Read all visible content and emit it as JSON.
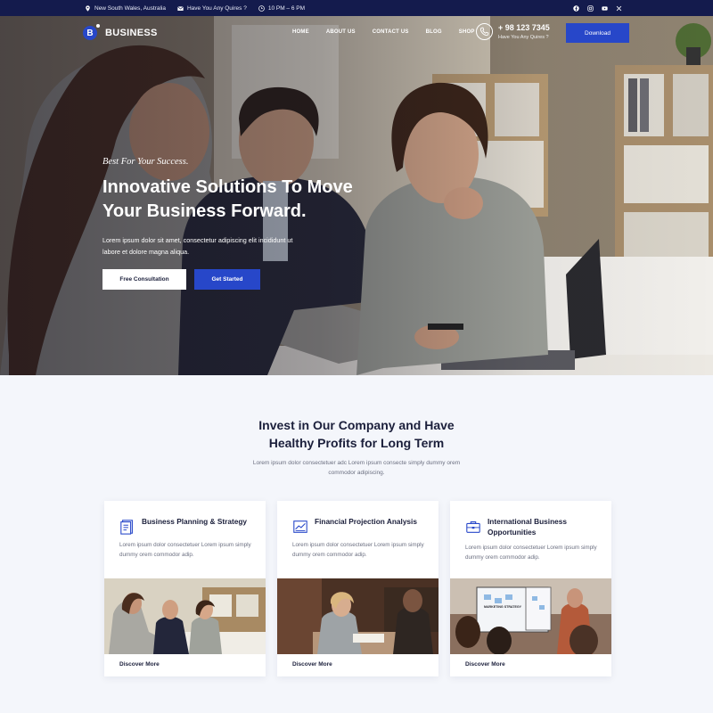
{
  "topbar": {
    "location": "New South Wales, Australia",
    "email": "Have You Any Quires ?",
    "hours": "10 PM – 6 PM",
    "socials": [
      "facebook-icon",
      "instagram-icon",
      "youtube-icon",
      "x-icon"
    ]
  },
  "nav": {
    "logo_letter": "B",
    "logo_text": "BUSINESS",
    "menu": [
      "HOME",
      "ABOUT US",
      "CONTACT US",
      "BLOG",
      "SHOP"
    ],
    "phone_number": "+ 98 123 7345",
    "phone_sub": "Have You Any Quires ?",
    "download_label": "Download"
  },
  "hero": {
    "tagline": "Best For Your Success.",
    "title_line1": "Innovative Solutions To Move",
    "title_line2": "Your Business Forward.",
    "desc": "Lorem ipsum dolor sit amet, consectetur adipiscing elit incididunt ut labore et dolore magna aliqua.",
    "btn_consult": "Free Consultation",
    "btn_start": "Get Started"
  },
  "section": {
    "title_line1": "Invest in Our Company and Have",
    "title_line2": "Healthy Profits for Long Term",
    "desc": "Lorem ipsum dolor consectetuer adc Lorem ipsum consecte simply dummy orem commodor adipiscing."
  },
  "cards": [
    {
      "title": "Business Planning & Strategy",
      "desc": "Lorem ipsum dolor consectetuer Lorem ipsum simply dummy orem commodor adip.",
      "link": "Discover More",
      "icon": "document-icon"
    },
    {
      "title": "Financial Projection Analysis",
      "desc": "Lorem ipsum dolor consectetuer Lorem ipsum simply dummy orem commodor adip.",
      "link": "Discover More",
      "icon": "chart-icon"
    },
    {
      "title": "International Business Opportunities",
      "desc": "Lorem ipsum dolor consectetuer Lorem ipsum simply dummy orem commodor adip.",
      "link": "Discover More",
      "icon": "briefcase-icon"
    }
  ],
  "card3_board_text": "MARKETING STRATEGY",
  "colors": {
    "navy": "#141b4d",
    "brand_blue": "#2747c9",
    "bg": "#f4f6fb"
  }
}
